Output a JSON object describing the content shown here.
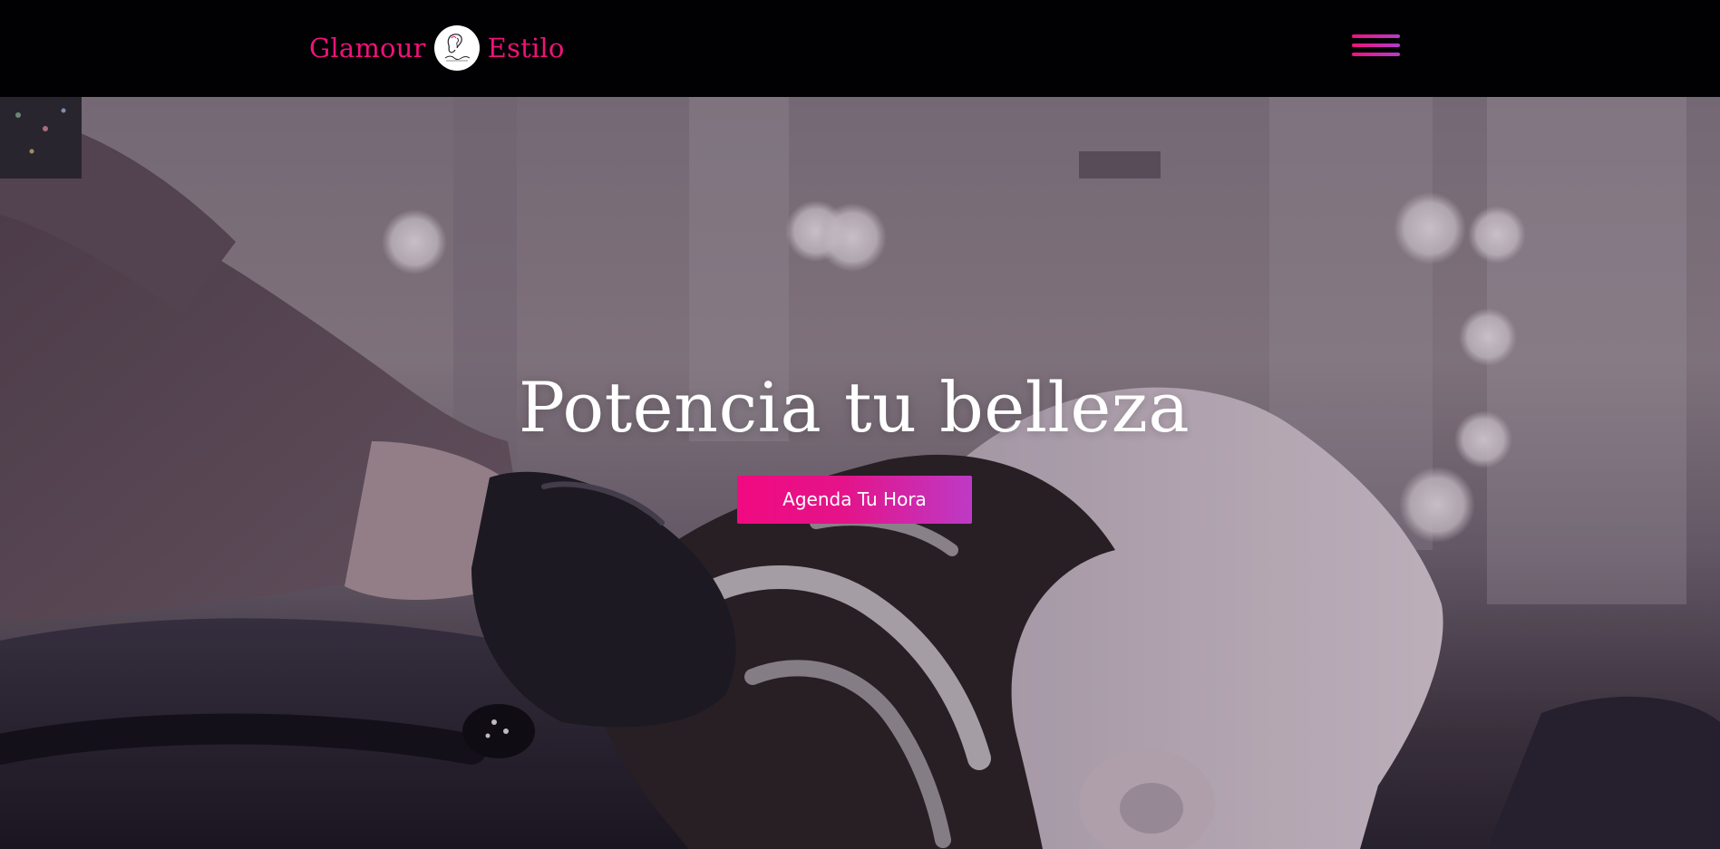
{
  "header": {
    "brand_left": "Glamour",
    "brand_right": "Estilo",
    "logo_icon": "salon-logo-icon",
    "menu_icon": "hamburger-menu-icon"
  },
  "hero": {
    "title": "Potencia tu belleza",
    "cta_label": "Agenda Tu Hora",
    "background": "hair-washing-salon-photo"
  },
  "colors": {
    "brand_pink": "#f0127b",
    "brand_purple": "#b53ccd",
    "header_bg": "#010002",
    "title_text": "#ffffff"
  }
}
